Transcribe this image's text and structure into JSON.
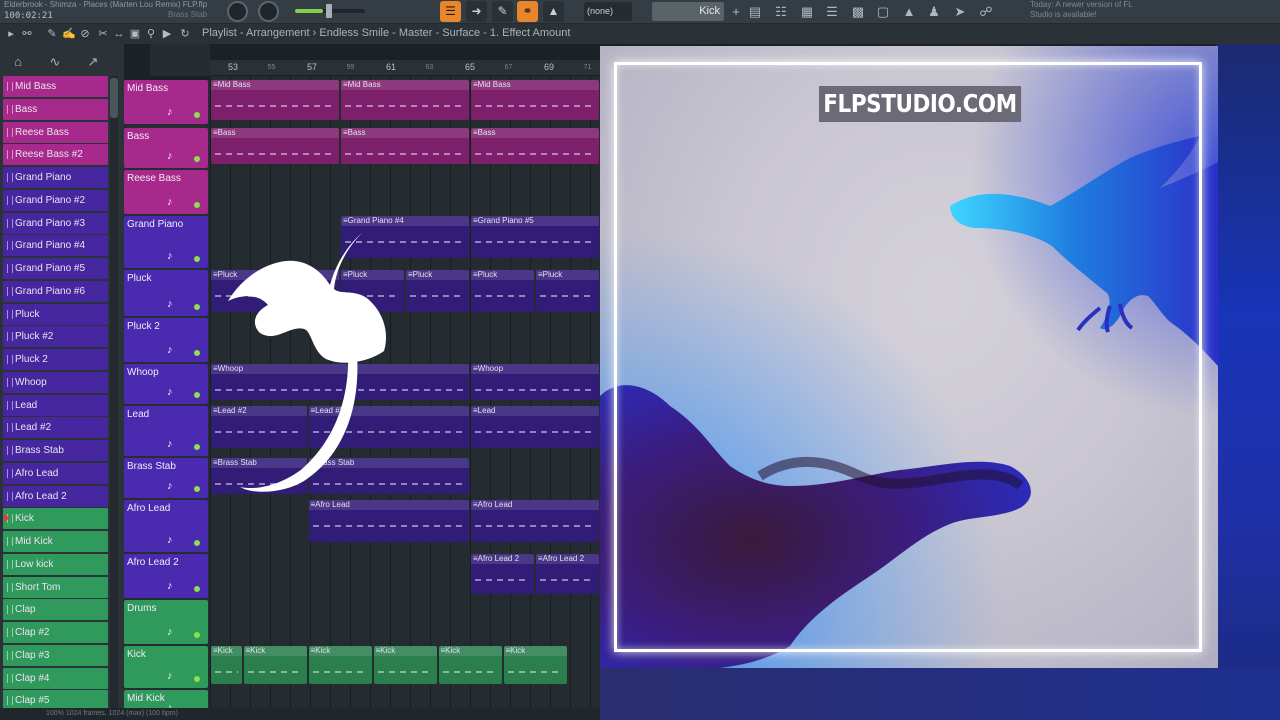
{
  "header": {
    "song_title": "Elderbrook - Shimza - Places (Marten Lou Remix) FLP.flp",
    "song_time": "100:02:21",
    "hint": "Brass Stab",
    "pattern": "(none)",
    "channel": "Kick",
    "update_note": "Today: A newer version of FL Studio is available!"
  },
  "breadcrumb": "Playlist - Arrangement  ›  Endless Smile - Master - Surface - 1. Effect Amount",
  "ruler": {
    "bars": [
      "53",
      "55",
      "57",
      "59",
      "61",
      "63",
      "65",
      "67",
      "69",
      "71"
    ],
    "major": [
      "53",
      "57",
      "61",
      "65",
      "69"
    ]
  },
  "channels": [
    {
      "label": "Mid Bass",
      "color": "magenta"
    },
    {
      "label": "Bass",
      "color": "magenta"
    },
    {
      "label": "Reese Bass",
      "color": "magenta"
    },
    {
      "label": "Reese Bass #2",
      "color": "magenta"
    },
    {
      "label": "Grand Piano",
      "color": "indigo"
    },
    {
      "label": "Grand Piano #2",
      "color": "indigo"
    },
    {
      "label": "Grand Piano #3",
      "color": "indigo"
    },
    {
      "label": "Grand Piano #4",
      "color": "indigo"
    },
    {
      "label": "Grand Piano #5",
      "color": "indigo"
    },
    {
      "label": "Grand Piano #6",
      "color": "indigo"
    },
    {
      "label": "Pluck",
      "color": "indigo"
    },
    {
      "label": "Pluck #2",
      "color": "indigo"
    },
    {
      "label": "Pluck 2",
      "color": "indigo"
    },
    {
      "label": "Whoop",
      "color": "indigo"
    },
    {
      "label": "Lead",
      "color": "indigo"
    },
    {
      "label": "Lead #2",
      "color": "indigo"
    },
    {
      "label": "Brass Stab",
      "color": "indigo"
    },
    {
      "label": "Afro Lead",
      "color": "indigo"
    },
    {
      "label": "Afro Lead 2",
      "color": "indigo"
    },
    {
      "label": "Kick",
      "color": "green",
      "marked": true
    },
    {
      "label": "Mid Kick",
      "color": "green"
    },
    {
      "label": "Low kick",
      "color": "green"
    },
    {
      "label": "Short Tom",
      "color": "green"
    },
    {
      "label": "Clap",
      "color": "green"
    },
    {
      "label": "Clap #2",
      "color": "green"
    },
    {
      "label": "Clap #3",
      "color": "green"
    },
    {
      "label": "Clap #4",
      "color": "green"
    },
    {
      "label": "Clap #5",
      "color": "green"
    }
  ],
  "tracks": [
    {
      "label": "Mid Bass",
      "color": "magenta"
    },
    {
      "label": "Bass",
      "color": "magenta"
    },
    {
      "label": "Reese Bass",
      "color": "magenta"
    },
    {
      "label": "Grand Piano",
      "color": "indigo"
    },
    {
      "label": "Pluck",
      "color": "indigo"
    },
    {
      "label": "Pluck 2",
      "color": "indigo"
    },
    {
      "label": "Whoop",
      "color": "indigo"
    },
    {
      "label": "Lead",
      "color": "indigo"
    },
    {
      "label": "Brass Stab",
      "color": "indigo"
    },
    {
      "label": "Afro Lead",
      "color": "indigo"
    },
    {
      "label": "Afro Lead 2",
      "color": "indigo"
    },
    {
      "label": "Drums",
      "color": "green"
    },
    {
      "label": "Kick",
      "color": "green"
    },
    {
      "label": "Mid Kick",
      "color": "green"
    }
  ],
  "clips": [
    {
      "track": 0,
      "label": "Mid Bass",
      "bar": 0,
      "len": 4,
      "color": "magenta"
    },
    {
      "track": 0,
      "label": "Mid Bass",
      "bar": 4,
      "len": 4,
      "color": "magenta"
    },
    {
      "track": 0,
      "label": "Mid Bass",
      "bar": 8,
      "len": 4,
      "color": "magenta"
    },
    {
      "track": 1,
      "label": "Bass",
      "bar": 0,
      "len": 4,
      "color": "magenta"
    },
    {
      "track": 1,
      "label": "Bass",
      "bar": 4,
      "len": 4,
      "color": "magenta"
    },
    {
      "track": 1,
      "label": "Bass",
      "bar": 8,
      "len": 4,
      "color": "magenta"
    },
    {
      "track": 3,
      "label": "Grand Piano #4",
      "bar": 4,
      "len": 4,
      "color": "indigo"
    },
    {
      "track": 3,
      "label": "Grand Piano #5",
      "bar": 8,
      "len": 4,
      "color": "indigo"
    },
    {
      "track": 4,
      "label": "Pluck",
      "bar": 0,
      "len": 4,
      "color": "indigo"
    },
    {
      "track": 4,
      "label": "Pluck",
      "bar": 4,
      "len": 2,
      "color": "indigo"
    },
    {
      "track": 4,
      "label": "Pluck",
      "bar": 6,
      "len": 2,
      "color": "indigo"
    },
    {
      "track": 4,
      "label": "Pluck",
      "bar": 8,
      "len": 2,
      "color": "indigo"
    },
    {
      "track": 4,
      "label": "Pluck",
      "bar": 10,
      "len": 2,
      "color": "indigo"
    },
    {
      "track": 6,
      "label": "Whoop",
      "bar": 0,
      "len": 8,
      "color": "indigo"
    },
    {
      "track": 6,
      "label": "Whoop",
      "bar": 8,
      "len": 4,
      "color": "indigo"
    },
    {
      "track": 7,
      "label": "Lead #2",
      "bar": 0,
      "len": 3,
      "color": "indigo"
    },
    {
      "track": 7,
      "label": "Lead #2",
      "bar": 3,
      "len": 5,
      "color": "indigo"
    },
    {
      "track": 7,
      "label": "Lead",
      "bar": 8,
      "len": 4,
      "color": "indigo"
    },
    {
      "track": 8,
      "label": "Brass Stab",
      "bar": 0,
      "len": 3,
      "color": "indigo"
    },
    {
      "track": 8,
      "label": "Brass Stab",
      "bar": 3,
      "len": 5,
      "color": "indigo"
    },
    {
      "track": 9,
      "label": "Afro Lead",
      "bar": 3,
      "len": 5,
      "color": "indigo"
    },
    {
      "track": 9,
      "label": "Afro Lead",
      "bar": 8,
      "len": 4,
      "color": "indigo"
    },
    {
      "track": 10,
      "label": "Afro Lead 2",
      "bar": 8,
      "len": 2,
      "color": "indigo"
    },
    {
      "track": 10,
      "label": "Afro Lead 2",
      "bar": 10,
      "len": 2,
      "color": "indigo"
    },
    {
      "track": 12,
      "label": "Kick",
      "bar": 0,
      "len": 1,
      "color": "green"
    },
    {
      "track": 12,
      "label": "Kick",
      "bar": 1,
      "len": 2,
      "color": "green"
    },
    {
      "track": 12,
      "label": "Kick",
      "bar": 3,
      "len": 2,
      "color": "green"
    },
    {
      "track": 12,
      "label": "Kick",
      "bar": 5,
      "len": 2,
      "color": "green"
    },
    {
      "track": 12,
      "label": "Kick",
      "bar": 7,
      "len": 2,
      "color": "green"
    },
    {
      "track": 12,
      "label": "Kick",
      "bar": 9,
      "len": 2,
      "color": "green"
    }
  ],
  "overlay": {
    "watermark": "FLPSTUDIO.COM"
  },
  "status": "100%   1024 frames, 1024 (max) (100 bpm)",
  "colors": {
    "magenta": "#a8298c",
    "indigo": "#4627a0",
    "green": "#2f9a5c",
    "accent_orange": "#e8862c"
  },
  "icons": {
    "play": "play-icon",
    "record": "record-icon",
    "link": "link-icon",
    "snap": "magnet-icon"
  }
}
